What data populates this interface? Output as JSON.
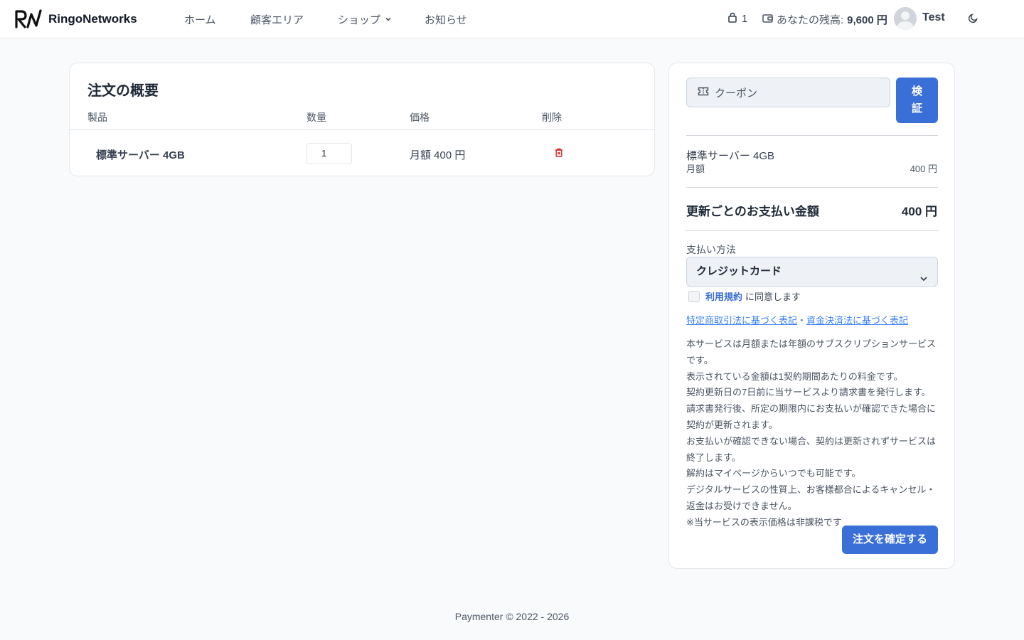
{
  "header": {
    "brand": "RingoNetworks",
    "nav": {
      "home": "ホーム",
      "client_area": "顧客エリア",
      "shop": "ショップ",
      "news": "お知らせ"
    },
    "cart_count": "1",
    "balance_label": "あなたの残高:",
    "balance_value": "9,600 円",
    "username": "Test"
  },
  "order": {
    "title": "注文の概要",
    "columns": {
      "product": "製品",
      "quantity": "数量",
      "price": "価格",
      "remove": "削除"
    },
    "item": {
      "name": "標準サーバー 4GB",
      "quantity": "1",
      "price": "月額 400 円"
    }
  },
  "checkout": {
    "coupon_placeholder": "クーポン",
    "verify_label": "検証",
    "summary": {
      "name": "標準サーバー 4GB",
      "period": "月額",
      "price": "400 円"
    },
    "total_label": "更新ごとのお支払い金額",
    "total_value": "400 円",
    "payment_method_label": "支払い方法",
    "payment_method_value": "クレジットカード",
    "tos_link": "利用規約",
    "tos_text": "に同意します",
    "link_1": "特定商取引法に基づく表記",
    "link_separator": "・",
    "link_2": "資金決済法に基づく表記",
    "policy_lines": [
      "本サービスは月額または年額のサブスクリプションサービスです。",
      "表示されている金額は1契約期間あたりの料金です。",
      "契約更新日の7日前に当サービスより請求書を発行します。",
      "請求書発行後、所定の期限内にお支払いが確認できた場合に契約が更新されます。",
      "お支払いが確認できない場合、契約は更新されずサービスは終了します。",
      "解約はマイページからいつでも可能です。",
      "デジタルサービスの性質上、お客様都合によるキャンセル・返金はお受けできません。",
      "※当サービスの表示価格は非課税です"
    ],
    "confirm_label": "注文を確定する"
  },
  "footer": {
    "text": "Paymenter © 2022 - 2026"
  },
  "colors": {
    "accent": "#3b6fd8",
    "danger": "#dc2626",
    "background": "#f8fafc"
  },
  "icons": [
    "logo-icon",
    "chevron-down-icon",
    "cart-icon",
    "wallet-icon",
    "avatar-icon",
    "moon-icon",
    "trash-icon",
    "ticket-icon"
  ]
}
